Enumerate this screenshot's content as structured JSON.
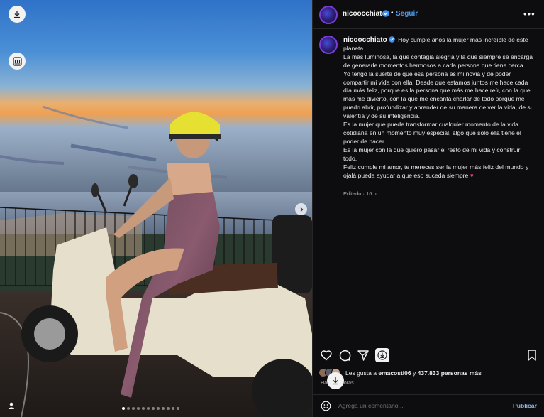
{
  "post": {
    "username": "nicoocchiato",
    "follow_label": "Seguir",
    "separator": "•",
    "more_label": "•••",
    "caption_paragraphs": [
      "Hoy cumple años la mujer más increíble de este planeta.",
      "La más luminosa, la que contagia alegría y la que siempre se encarga de generarle momentos hermosos a cada persona que tiene cerca.",
      "Yo tengo la suerte de que esa persona es mi novia y de poder compartir mi vida con ella. Desde que estamos juntos me hace cada día más feliz, porque es la persona que más me hace reír, con la que más me divierto, con la que me encanta charlar de todo porque me puedo abrir, profundizar y aprender de su manera de ver la vida, de su valentía y de su inteligencia.",
      "Es la mujer que puede transformar cualquier momento de la vida cotidiana en un momento muy especial, algo que solo ella tiene el poder de hacer.",
      "Es la mujer con la que quiero pasar el resto de mi vida y construir todo.",
      "Feliz cumple mi amor, te mereces ser la mujer más feliz del mundo y ojalá pueda ayudar a que eso suceda siempre"
    ],
    "caption_emoji": "♥",
    "edited_label": "Editado · 16 h",
    "likes": {
      "prefix": "Les gusta a ",
      "user": "emacosti06",
      "middle": " y ",
      "count": "437.833 personas más"
    },
    "time_label": "Hace 16 horas",
    "comment_placeholder": "Agrega un comentario...",
    "publish_label": "Publicar"
  },
  "carousel": {
    "slides": 12,
    "active_index": 0
  },
  "icons": {
    "download": "download-icon",
    "gallery": "gallery-icon",
    "next": "chevron-right-icon",
    "user": "user-tag-icon",
    "like": "heart-icon",
    "comment": "comment-icon",
    "share": "share-icon",
    "save": "bookmark-icon",
    "emoji": "emoji-icon",
    "verified": "verified-badge-icon"
  },
  "colors": {
    "accent": "#4a9cf0",
    "background": "#0d0d0f",
    "heart": "#ff3b6b"
  }
}
